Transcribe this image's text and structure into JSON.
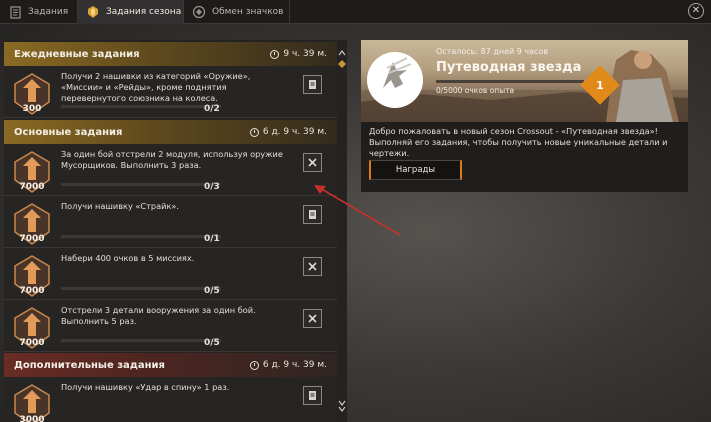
{
  "tabs": [
    {
      "label": "Задания",
      "icon": "quests-icon",
      "active": false
    },
    {
      "label": "Задания сезона",
      "icon": "season-quests-icon",
      "active": true
    },
    {
      "label": "Обмен значков",
      "icon": "badge-exchange-icon",
      "active": false
    }
  ],
  "sections": {
    "daily": {
      "title": "Ежедневные задания",
      "timer": "9 ч. 39 м."
    },
    "main": {
      "title": "Основные задания",
      "timer": "6 д. 9 ч. 39 м."
    },
    "extra": {
      "title": "Дополнительные задания",
      "timer": "6 д. 9 ч. 39 м."
    }
  },
  "tasks": [
    {
      "points": "300",
      "desc": "Получи 2 нашивки из категорий «Оружие», «Миссии» и «Рейды», кроме поднятия перевернутого союзника на колеса.",
      "progress": "0/2",
      "fill": 0,
      "icon": "document-icon"
    },
    {
      "points": "7000",
      "desc": "За один бой отстрели 2 модуля, используя оружие Мусорщиков. Выполнить 3 раза.",
      "progress": "0/3",
      "fill": 0,
      "icon": "crossed-guns-icon"
    },
    {
      "points": "7000",
      "desc": "Получи нашивку «Страйк».",
      "progress": "0/1",
      "fill": 0,
      "icon": "document-icon"
    },
    {
      "points": "7000",
      "desc": "Набери 400 очков в 5 миссиях.",
      "progress": "0/5",
      "fill": 0,
      "icon": "crossed-guns-icon"
    },
    {
      "points": "7000",
      "desc": "Отстрели 3 детали вооружения за один бой. Выполнить 5 раз.",
      "progress": "0/5",
      "fill": 0,
      "icon": "crossed-guns-icon"
    },
    {
      "points": "3000",
      "desc": "Получи нашивку «Удар в спину» 1 раз.",
      "progress": "",
      "fill": 0,
      "icon": "document-icon"
    }
  ],
  "season": {
    "remaining": "Осталось: 87 дней 9 часов",
    "title": "Путеводная звезда",
    "xp": "0/5000 очков опыта",
    "xp_fill": 0,
    "level": "1",
    "welcome": "Добро пожаловать в новый сезон Crossout - «Путеводная звезда»! Выполняй его задания, чтобы получить новые уникальные детали и чертежи.",
    "rewards_label": "Награды"
  },
  "colors": {
    "accent": "#e0771c",
    "level_badge": "#e08a1a",
    "daily_header": "#8a6a24",
    "extra_header": "#6a2c25",
    "arrow": "#c9302a"
  }
}
